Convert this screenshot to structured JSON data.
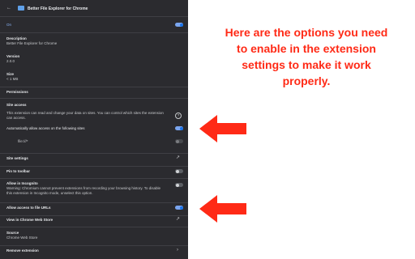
{
  "header": {
    "title": "Better File Explorer for Chrome",
    "back_icon": "back-arrow-icon",
    "ext_icon": "folder-icon"
  },
  "on_row": {
    "label": "On"
  },
  "details": [
    {
      "label": "Description",
      "value": "Better File Explorer for Chrome"
    },
    {
      "label": "Version",
      "value": "2.0.0"
    },
    {
      "label": "Size",
      "value": "< 1 MB"
    }
  ],
  "permissions_label": "Permissions",
  "site_access": {
    "title": "Site access",
    "desc": "This extension can read and change your data on sites. You can control which sites the extension can access.",
    "auto_allow_label": "Automatically allow access on the following sites",
    "site_label": "file:///*"
  },
  "site_settings_label": "Site settings",
  "pin_toolbar_label": "Pin to toolbar",
  "incognito": {
    "title": "Allow in Incognito",
    "warning": "Warning: Chromium cannot prevent extensions from recording your browsing history. To disable this extension in Incognito mode, unselect this option."
  },
  "file_urls_label": "Allow access to file URLs",
  "store_label": "View in Chrome Web Store",
  "source": {
    "label": "Source",
    "value": "Chrome Web Store"
  },
  "remove_label": "Remove extension",
  "annotation": "Here are the options you need to enable in the extension settings to make it work properly.",
  "colors": {
    "accent": "#1a73e8",
    "arrow": "#ff2a16",
    "panel_bg": "#2b2b2f"
  }
}
